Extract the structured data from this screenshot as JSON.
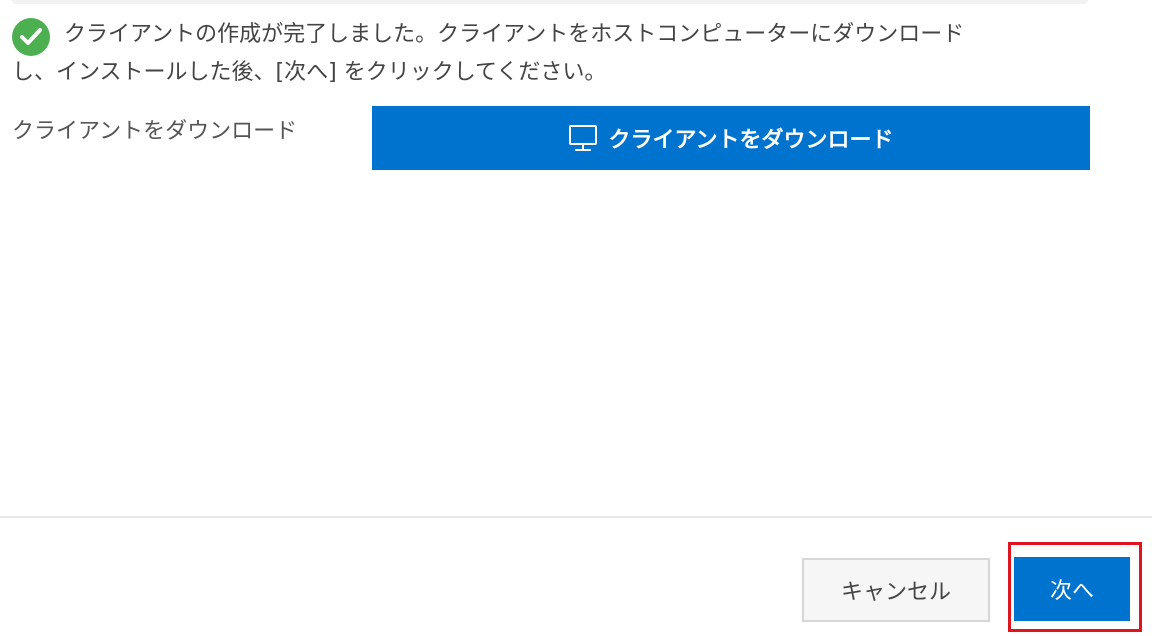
{
  "message": {
    "line1": "クライアントの作成が完了しました。クライアントをホストコンピューターにダウンロード",
    "line2": "し、インストールした後、[次へ] をクリックしてください。",
    "icon": "check-circle-icon",
    "icon_color": "#4caf50"
  },
  "download": {
    "label": "クライアントをダウンロード",
    "button_label": "クライアントをダウンロード",
    "button_icon": "monitor-icon",
    "button_color": "#0073cf"
  },
  "footer": {
    "cancel_label": "キャンセル",
    "next_label": "次へ",
    "next_color": "#0073cf",
    "highlight_color": "#e0141e"
  }
}
